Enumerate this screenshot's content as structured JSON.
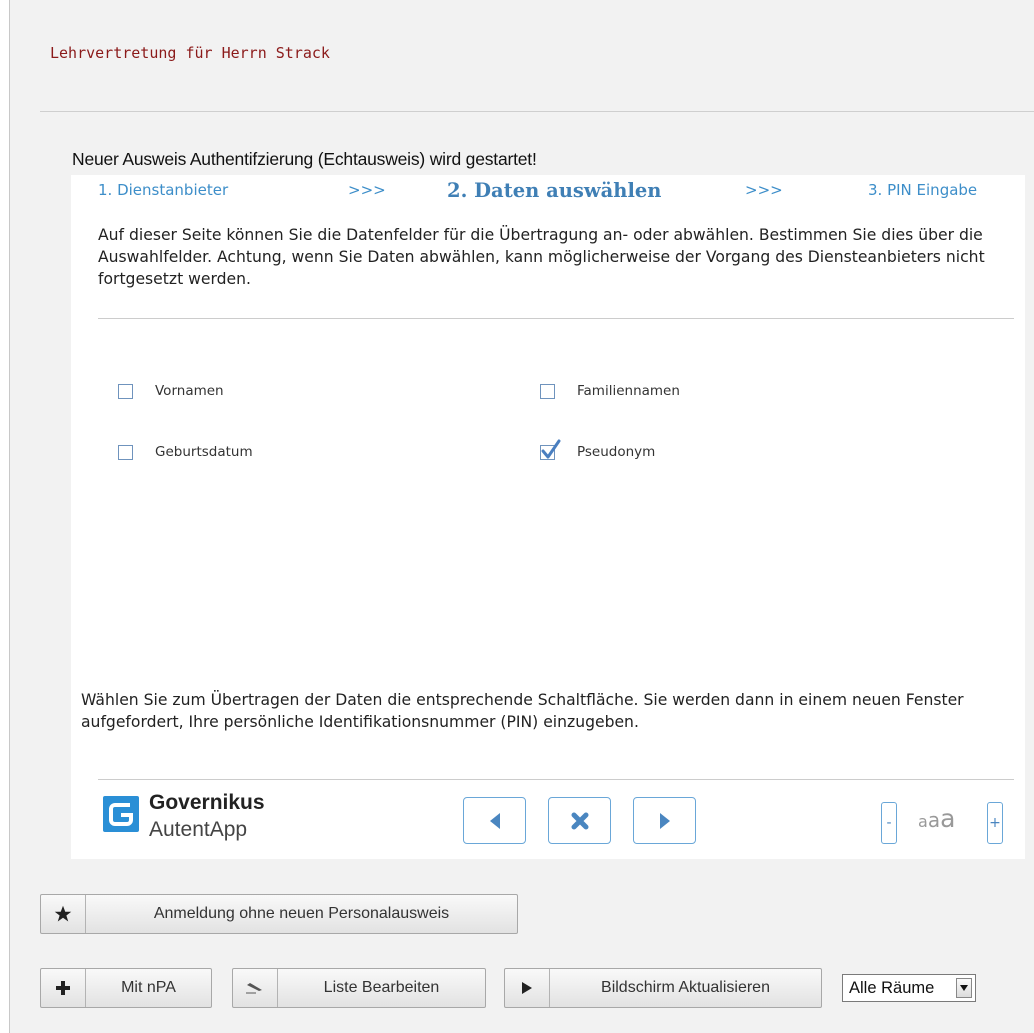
{
  "page": {
    "title": "Lehrvertretung für Herrn Strack"
  },
  "dialog": {
    "heading": "Neuer Ausweis Authentifzierung (Echtausweis) wird gestartet!",
    "steps": [
      {
        "label": "1. Dienstanbieter",
        "active": false
      },
      {
        "label": ">>>"
      },
      {
        "label": "2. Daten auswählen",
        "active": true
      },
      {
        "label": ">>>"
      },
      {
        "label": "3. PIN Eingabe",
        "active": false
      }
    ],
    "intro_text": "Auf dieser Seite können Sie die Datenfelder für die Übertragung an- oder abwählen. Bestimmen Sie dies über die Auswahlfelder. Achtung, wenn Sie Daten abwählen, kann möglicherweise der Vorgang des Diensteanbieters nicht fortgesetzt werden.",
    "fields": [
      {
        "label": "Vornamen",
        "checked": false
      },
      {
        "label": "Familiennamen",
        "checked": false
      },
      {
        "label": "Geburtsdatum",
        "checked": false
      },
      {
        "label": "Pseudonym",
        "checked": true
      }
    ],
    "outro_text": "Wählen Sie zum Übertragen der Daten die entsprechende Schaltfläche. Sie werden dann in einem neuen Fenster aufgefordert, Ihre persönliche Identifikationsnummer (PIN) einzugeben.",
    "brand": {
      "line1": "Governikus",
      "line2": "AutentApp",
      "color": "#2a8fd6"
    },
    "nav_buttons": [
      "back-icon",
      "cancel-icon",
      "forward-icon"
    ],
    "font_size_controls": {
      "decrease": "-",
      "increase": "+",
      "sample": [
        "a",
        "a",
        "a"
      ]
    }
  },
  "actions": {
    "login_without_id": {
      "label": "Anmeldung ohne neuen Personalausweis",
      "icon": "star-icon"
    },
    "with_npa": {
      "label": "Mit nPA",
      "icon": "plus-icon"
    },
    "edit_list": {
      "label": "Liste Bearbeiten",
      "icon": "edit-icon"
    },
    "refresh": {
      "label": "Bildschirm Aktualisieren",
      "icon": "play-icon"
    },
    "room_select": {
      "value": "Alle Räume"
    }
  },
  "colors": {
    "accent": "#3d8ec9",
    "title": "#8b1a1a",
    "checkbox": "#6f93bd"
  }
}
